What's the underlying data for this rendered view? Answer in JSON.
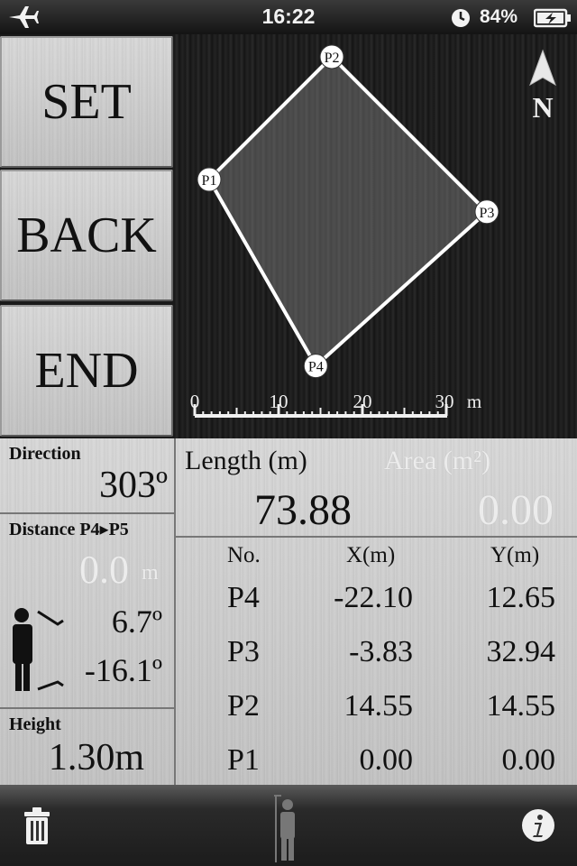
{
  "status_bar": {
    "time": "16:22",
    "battery": "84%",
    "airplane_icon": "airplane-icon",
    "clock_icon": "clock-icon",
    "battery_icon": "battery-charging-icon"
  },
  "buttons": {
    "set": "SET",
    "back": "BACK",
    "end": "END"
  },
  "plot": {
    "points": [
      {
        "label": "P1",
        "x": 0.0,
        "y": 0.0
      },
      {
        "label": "P2",
        "x": 14.55,
        "y": 14.55
      },
      {
        "label": "P3",
        "x": 32.94,
        "y": -3.83
      },
      {
        "label": "P4",
        "x": 12.65,
        "y": -22.1
      }
    ],
    "scale_ticks": [
      "0",
      "10",
      "20",
      "30"
    ],
    "scale_unit": "m",
    "north": "N"
  },
  "direction": {
    "label": "Direction",
    "value": "303º"
  },
  "distance": {
    "label": "Distance P4▸P5",
    "value": "0.0",
    "unit": "m",
    "angle_up": "6.7º",
    "angle_down": "-16.1º"
  },
  "height": {
    "label": "Height",
    "value": "1.30m"
  },
  "length": {
    "label": "Length (m)",
    "value": "73.88"
  },
  "area": {
    "label": "Area (m²)",
    "value": "0.00"
  },
  "table": {
    "headers": [
      "No.",
      "X(m)",
      "Y(m)"
    ],
    "rows": [
      [
        "P4",
        "-22.10",
        "12.65"
      ],
      [
        "P3",
        "-3.83",
        "32.94"
      ],
      [
        "P2",
        "14.55",
        "14.55"
      ],
      [
        "P1",
        "0.00",
        "0.00"
      ]
    ]
  }
}
